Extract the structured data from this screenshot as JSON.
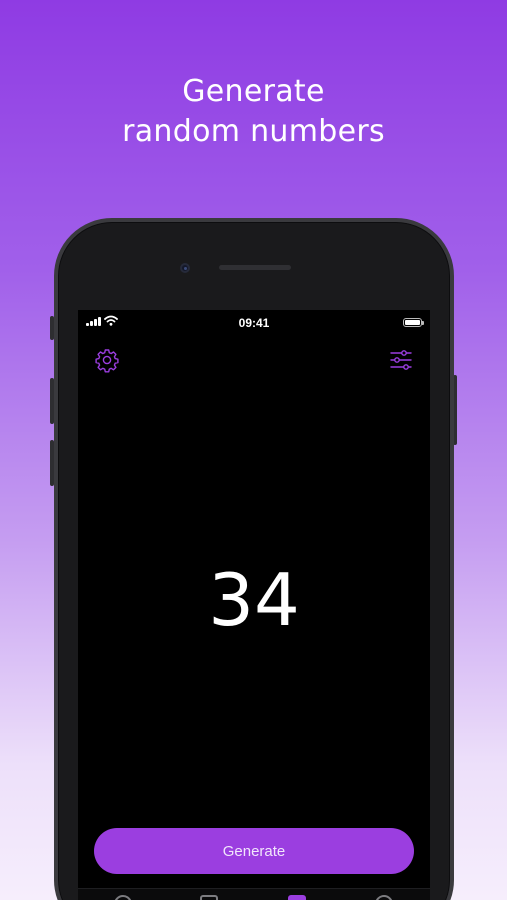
{
  "headline": {
    "line1": "Generate",
    "line2": "random numbers"
  },
  "status_bar": {
    "time": "09:41"
  },
  "toolbar": {
    "settings_icon": "gear-icon",
    "filters_icon": "sliders-icon"
  },
  "main": {
    "random_number": "34"
  },
  "actions": {
    "generate_label": "Generate"
  },
  "tab_bar": {
    "tabs": [
      {
        "icon": "circle-icon",
        "active": false
      },
      {
        "icon": "square-icon",
        "active": false
      },
      {
        "icon": "square-icon",
        "active": true
      },
      {
        "icon": "circle-icon",
        "active": false
      }
    ]
  },
  "colors": {
    "accent": "#9b3ee0",
    "background_top": "#8f3be3",
    "screen_background": "#000000"
  }
}
